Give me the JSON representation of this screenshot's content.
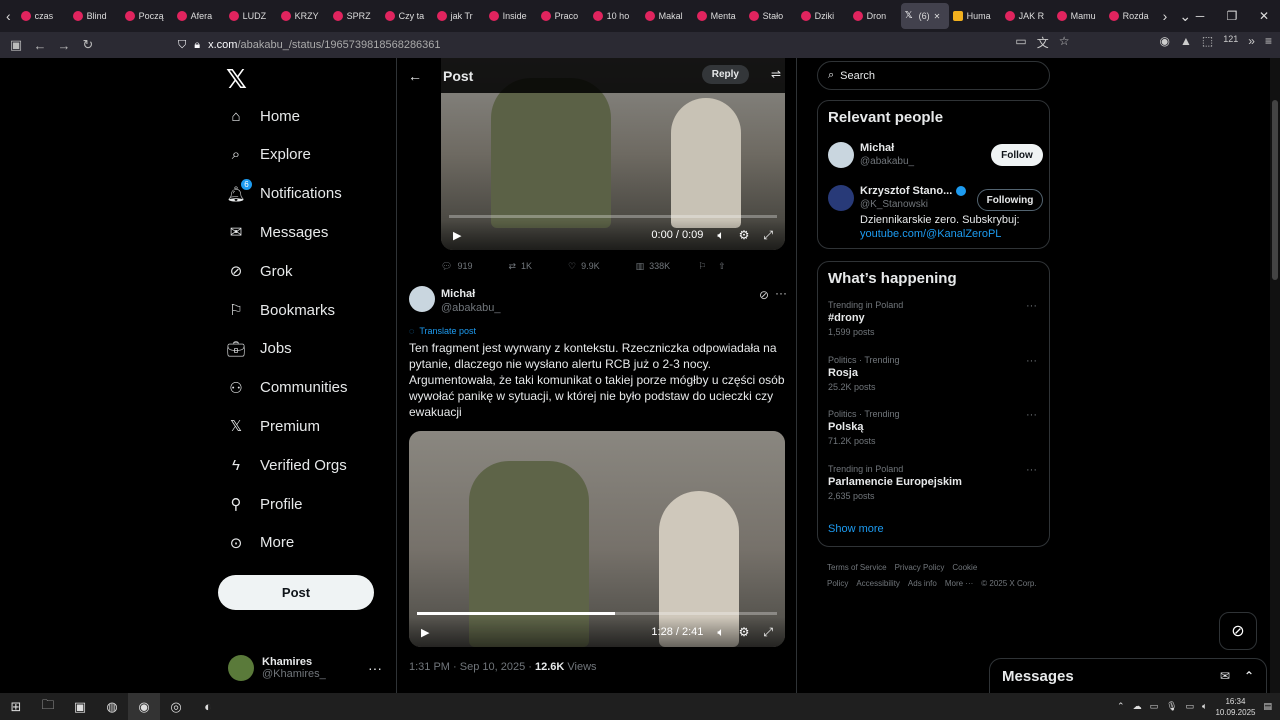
{
  "browser": {
    "tabs": [
      {
        "label": "czas",
        "fav": "red"
      },
      {
        "label": "Blind",
        "fav": "red"
      },
      {
        "label": "Począ",
        "fav": "red"
      },
      {
        "label": "Afera",
        "fav": "red"
      },
      {
        "label": "LUDZ",
        "fav": "red"
      },
      {
        "label": "KRZY",
        "fav": "red"
      },
      {
        "label": "SPRZ",
        "fav": "red"
      },
      {
        "label": "Czy ta",
        "fav": "red"
      },
      {
        "label": "jak Tr",
        "fav": "red"
      },
      {
        "label": "Inside",
        "fav": "red"
      },
      {
        "label": "Praco",
        "fav": "red"
      },
      {
        "label": "10 ho",
        "fav": "red"
      },
      {
        "label": "Makal",
        "fav": "red"
      },
      {
        "label": "Menta",
        "fav": "red"
      },
      {
        "label": "Stało",
        "fav": "red"
      },
      {
        "label": "Dziki",
        "fav": "red"
      },
      {
        "label": "Dron",
        "fav": "red"
      },
      {
        "label": "(6)",
        "fav": "x",
        "active": true
      },
      {
        "label": "Huma",
        "fav": "yellow"
      },
      {
        "label": "JAK R",
        "fav": "red"
      },
      {
        "label": "Mamu",
        "fav": "red"
      },
      {
        "label": "Rozda",
        "fav": "red"
      }
    ],
    "url_domain": "x.com",
    "url_path": "/abakabu_/status/1965739818568286361",
    "notif_count": "121"
  },
  "sidebar": {
    "items": [
      {
        "label": "Home",
        "icon": "home-icon"
      },
      {
        "label": "Explore",
        "icon": "search-icon"
      },
      {
        "label": "Notifications",
        "icon": "bell-icon",
        "badge": "6"
      },
      {
        "label": "Messages",
        "icon": "mail-icon"
      },
      {
        "label": "Grok",
        "icon": "grok-icon"
      },
      {
        "label": "Bookmarks",
        "icon": "bookmark-icon"
      },
      {
        "label": "Jobs",
        "icon": "briefcase-icon"
      },
      {
        "label": "Communities",
        "icon": "people-icon"
      },
      {
        "label": "Premium",
        "icon": "x-logo-icon"
      },
      {
        "label": "Verified Orgs",
        "icon": "lightning-icon"
      },
      {
        "label": "Profile",
        "icon": "person-icon"
      },
      {
        "label": "More",
        "icon": "more-circle-icon"
      }
    ],
    "post_label": "Post",
    "me": {
      "name": "Khamires",
      "handle": "@Khamires_"
    }
  },
  "header": {
    "title": "Post",
    "reply_label": "Reply"
  },
  "video1": {
    "time": "0:00 / 0:09",
    "progress": 0.0
  },
  "actions": {
    "replies": "919",
    "reposts": "1K",
    "likes": "9.9K",
    "views": "338K"
  },
  "tweet": {
    "name": "Michał",
    "handle": "@abakabu_",
    "translate": "Translate post",
    "text": "Ten fragment jest wyrwany z kontekstu. Rzeczniczka odpowiadała na pytanie, dlaczego nie wysłano alertu RCB już o 2-3 nocy. Argumentowała, że taki komunikat o takiej porze mógłby u części osób wywołać panikę w sytuacji, w której nie było podstaw do ucieczki czy ewakuacji",
    "time": "1:31 PM · Sep 10, 2025 · ",
    "views_count": "12.6K",
    "views_label": " Views"
  },
  "video2": {
    "time": "1:28 / 2:41",
    "progress": 0.55
  },
  "search": {
    "placeholder": "Search"
  },
  "relevant": {
    "title": "Relevant people",
    "people": [
      {
        "name": "Michał",
        "handle": "@abakabu_",
        "button": "Follow"
      },
      {
        "name": "Krzysztof Stano...",
        "handle": "@K_Stanowski",
        "button": "Following",
        "verified": true,
        "bio": "Dziennikarskie zero. Subskrybuj: ",
        "link": "youtube.com/@KanalZeroPL"
      }
    ]
  },
  "happening": {
    "title": "What’s happening",
    "trends": [
      {
        "context": "Trending in Poland",
        "name": "#drony",
        "count": "1,599 posts"
      },
      {
        "context": "Politics · Trending",
        "name": "Rosja",
        "count": "25.2K posts"
      },
      {
        "context": "Politics · Trending",
        "name": "Polską",
        "count": "71.2K posts"
      },
      {
        "context": "Trending in Poland",
        "name": "Parlamencie Europejskim",
        "count": "2,635 posts"
      }
    ],
    "show_more": "Show more"
  },
  "footer": {
    "links": [
      "Terms of Service",
      "Privacy Policy",
      "Cookie Policy",
      "Accessibility",
      "Ads info",
      "More ···",
      "© 2025 X Corp."
    ]
  },
  "messages_dock": {
    "label": "Messages"
  },
  "taskbar": {
    "time": "16:34",
    "date": "10.09.2025"
  }
}
